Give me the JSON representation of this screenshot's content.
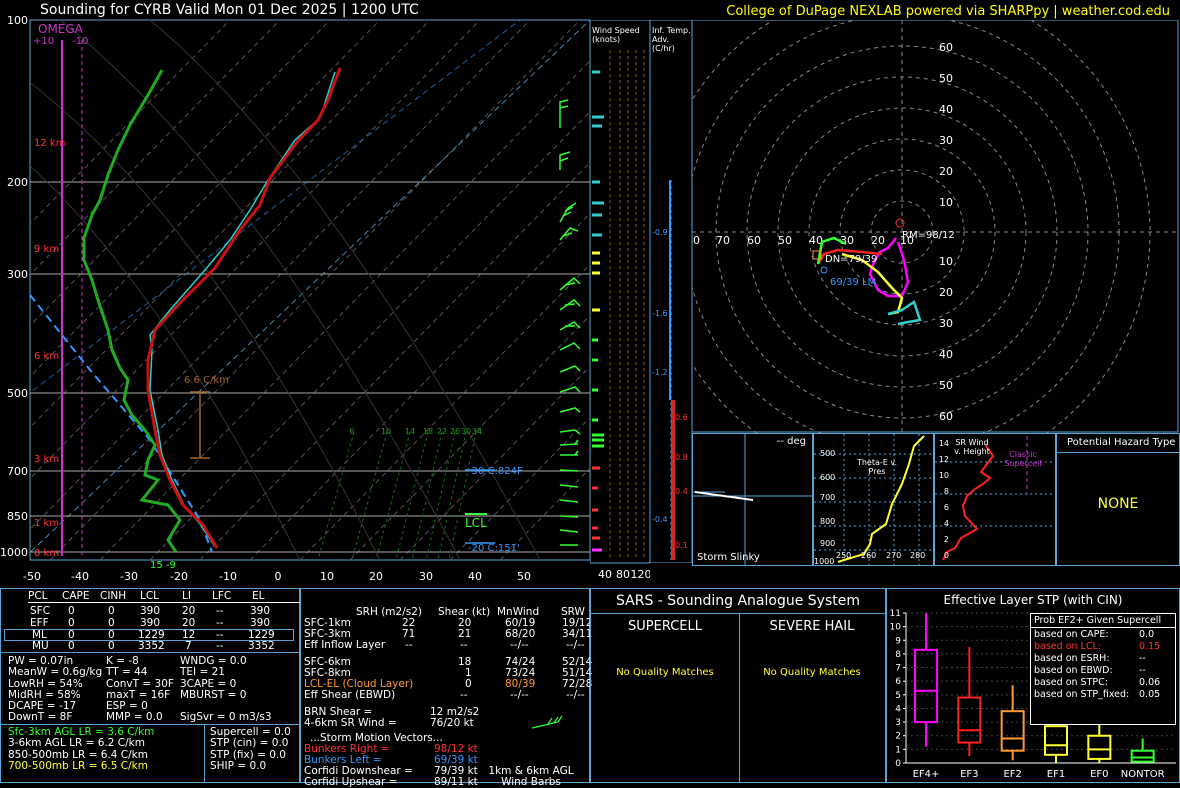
{
  "header": {
    "title": "Sounding for CYRB Valid  Mon 01 Dec 2025 | 1200 UTC",
    "credit": "College of DuPage NEXLAB powered via SHARPpy | weather.cod.edu"
  },
  "skewt": {
    "omega_label": "OMEGA",
    "omega_ticks": [
      "+10",
      "-10"
    ],
    "pressure_ticks": [
      "100",
      "200",
      "300",
      "500",
      "700",
      "850",
      "1000"
    ],
    "temp_ticks": [
      "-50",
      "-40",
      "-30",
      "-20",
      "-10",
      "0",
      "10",
      "20",
      "30",
      "40",
      "50"
    ],
    "height_labels": [
      "12 km",
      "9 km",
      "6 km",
      "3 km",
      "1 km",
      "0 km"
    ],
    "lapse_label": "6.6 C/km",
    "mixing_ratio_labels": [
      "6",
      "10",
      "14",
      "18",
      "22",
      "26",
      "30",
      "34"
    ],
    "minus30_label": "-30 C:824F",
    "minus20_label": "-20 C:151'",
    "lcl_label": "LCL",
    "sfc_label": "15  -9"
  },
  "wind_speed_panel": {
    "title": "Wind Speed (knots)",
    "ticks": [
      "40",
      "80",
      "120"
    ]
  },
  "inf_temp_panel": {
    "title": "Inf. Temp. Adv. (C/hr)",
    "labels": [
      "-0.9",
      "-1.6",
      "-1.2",
      "0.6",
      "0.8",
      "0.4",
      "-0.4",
      "0.1"
    ]
  },
  "hodograph": {
    "rings_y": [
      "60",
      "50",
      "40",
      "30",
      "20",
      "10",
      "10",
      "20",
      "30",
      "40",
      "50",
      "60"
    ],
    "rings_x": [
      "80",
      "70",
      "60",
      "50",
      "40",
      "30",
      "20",
      "10"
    ],
    "rm_label": "RM=98/12",
    "dn_label": "DN=79/39",
    "lm_label": "69/39 LM"
  },
  "storm_slinky": {
    "title": "-- deg",
    "label": "Storm Slinky"
  },
  "theta_panel": {
    "label": "Theta-E v. Pres",
    "y_ticks": [
      "500",
      "600",
      "700",
      "800",
      "900",
      "1000"
    ],
    "x_ticks": [
      "250",
      "260",
      "270",
      "280"
    ]
  },
  "srwind_panel": {
    "label": "SR Wind v. Height",
    "classic": "Classic Supercell",
    "y_ticks": [
      "14",
      "12",
      "10",
      "8",
      "6",
      "4",
      "2",
      "0"
    ]
  },
  "hazard": {
    "title": "Potential Hazard Type",
    "value": "NONE"
  },
  "parcels": {
    "headers": [
      "PCL",
      "CAPE",
      "CINH",
      "LCL",
      "LI",
      "LFC",
      "EL"
    ],
    "rows": [
      [
        "SFC",
        "0",
        "0",
        "390",
        "20",
        "--",
        "390"
      ],
      [
        "EFF",
        "0",
        "0",
        "390",
        "20",
        "--",
        "390"
      ],
      [
        "ML",
        "0",
        "0",
        "1229",
        "12",
        "--",
        "1229"
      ],
      [
        "MU",
        "0",
        "0",
        "3352",
        "7",
        "--",
        "3352"
      ]
    ]
  },
  "indices": {
    "col1": [
      "PW = 0.07in",
      "MeanW = 0.6g/kg",
      "LowRH = 54%",
      "MidRH = 58%",
      "DCAPE = -17",
      "DownT = 8F"
    ],
    "col2": [
      "K = -8",
      "TT = 44",
      "ConvT = 30F",
      "maxT = 16F",
      "ESP = 0",
      "MMP = 0.0"
    ],
    "col3": [
      "WNDG = 0.0",
      "TEI = 21",
      "3CAPE = 0",
      "MBURST = 0",
      "",
      "SigSvr = 0 m3/s3"
    ]
  },
  "lapse_rates": [
    "Sfc-3km AGL LR = 3.6 C/km",
    "3-6km AGL LR = 6.2 C/km",
    "850-500mb LR = 6.4 C/km",
    "700-500mb LR = 6.5 C/km"
  ],
  "composites": [
    "Supercell = 0.0",
    "STP (cin) = 0.0",
    "STP (fix) = 0.0",
    "SHIP = 0.0"
  ],
  "kinematics": {
    "headers": [
      "SRH (m2/s2)",
      "Shear (kt)",
      "MnWind",
      "SRW"
    ],
    "rows": [
      [
        "SFC-1km",
        "22",
        "20",
        "60/19",
        "19/12"
      ],
      [
        "SFC-3km",
        "71",
        "21",
        "68/20",
        "34/11"
      ],
      [
        "Eff Inflow Layer",
        "--",
        "--",
        "--/--",
        "--/--"
      ],
      [
        "SFC-6km",
        "",
        "18",
        "74/24",
        "52/14"
      ],
      [
        "SFC-8km",
        "",
        "1",
        "73/24",
        "51/14"
      ],
      [
        "LCL-EL (Cloud Layer)",
        "",
        "0",
        "80/39",
        "72/28"
      ],
      [
        "Eff Shear (EBWD)",
        "",
        "--",
        "--/--",
        "--/--"
      ]
    ],
    "brn_shear": "BRN Shear =",
    "brn_shear_val": "12 m2/s2",
    "sr_wind": "4-6km SR Wind =",
    "sr_wind_val": "76/20 kt",
    "storm_motion": "...Storm Motion Vectors...",
    "bunkers_right": "Bunkers Right =",
    "bunkers_right_val": "98/12 kt",
    "bunkers_left": "Bunkers Left =",
    "bunkers_left_val": "69/39 kt",
    "corfidi_down": "Corfidi Downshear =",
    "corfidi_down_val": "79/39 kt",
    "corfidi_up": "Corfidi Upshear =",
    "corfidi_up_val": "89/11 kt",
    "barb_caption": "1km & 6km AGL Wind Barbs"
  },
  "sars": {
    "title": "SARS - Sounding Analogue System",
    "supercell": "SUPERCELL",
    "hail": "SEVERE HAIL",
    "supercell_result": "No Quality Matches",
    "hail_result": "No Quality Matches"
  },
  "stp_panel": {
    "title": "Effective Layer STP (with CIN)",
    "legend_title": "Prob EF2+ Given Supercell",
    "legend": [
      [
        "based on CAPE:",
        "0.0"
      ],
      [
        "based on LCL:",
        "0.15"
      ],
      [
        "based on ESRH:",
        "--"
      ],
      [
        "based on EBWD:",
        "--"
      ],
      [
        "based on STPC:",
        "0.06"
      ],
      [
        "based on STP_fixed:",
        "0.05"
      ]
    ],
    "y_ticks": [
      "11",
      "10",
      "9",
      "8",
      "7",
      "6",
      "5",
      "4",
      "3",
      "2",
      "1",
      "0"
    ],
    "categories": [
      "EF4+",
      "EF3",
      "EF2",
      "EF1",
      "EF0",
      "NONTOR"
    ]
  },
  "chart_data": {
    "type": "box",
    "title": "Effective Layer STP (with CIN)",
    "categories": [
      "EF4+",
      "EF3",
      "EF2",
      "EF1",
      "EF0",
      "NONTOR"
    ],
    "ylim": [
      0,
      11
    ],
    "boxes": [
      {
        "name": "EF4+",
        "min": 1.2,
        "q1": 3.0,
        "median": 5.3,
        "q3": 8.3,
        "max": 11.0,
        "color": "#ff00ff"
      },
      {
        "name": "EF3",
        "min": 0.5,
        "q1": 1.5,
        "median": 2.4,
        "q3": 4.8,
        "max": 8.5,
        "color": "#ff2222"
      },
      {
        "name": "EF2",
        "min": 0.2,
        "q1": 0.9,
        "median": 1.8,
        "q3": 3.8,
        "max": 5.7,
        "color": "#ff9933"
      },
      {
        "name": "EF1",
        "min": 0.0,
        "q1": 0.6,
        "median": 1.3,
        "q3": 2.7,
        "max": 4.5,
        "color": "#ffff33"
      },
      {
        "name": "EF0",
        "min": 0.0,
        "q1": 0.3,
        "median": 1.0,
        "q3": 2.0,
        "max": 3.8,
        "color": "#ffff33"
      },
      {
        "name": "NONTOR",
        "min": 0.0,
        "q1": 0.1,
        "median": 0.4,
        "q3": 0.9,
        "max": 1.8,
        "color": "#33ff33"
      }
    ]
  }
}
